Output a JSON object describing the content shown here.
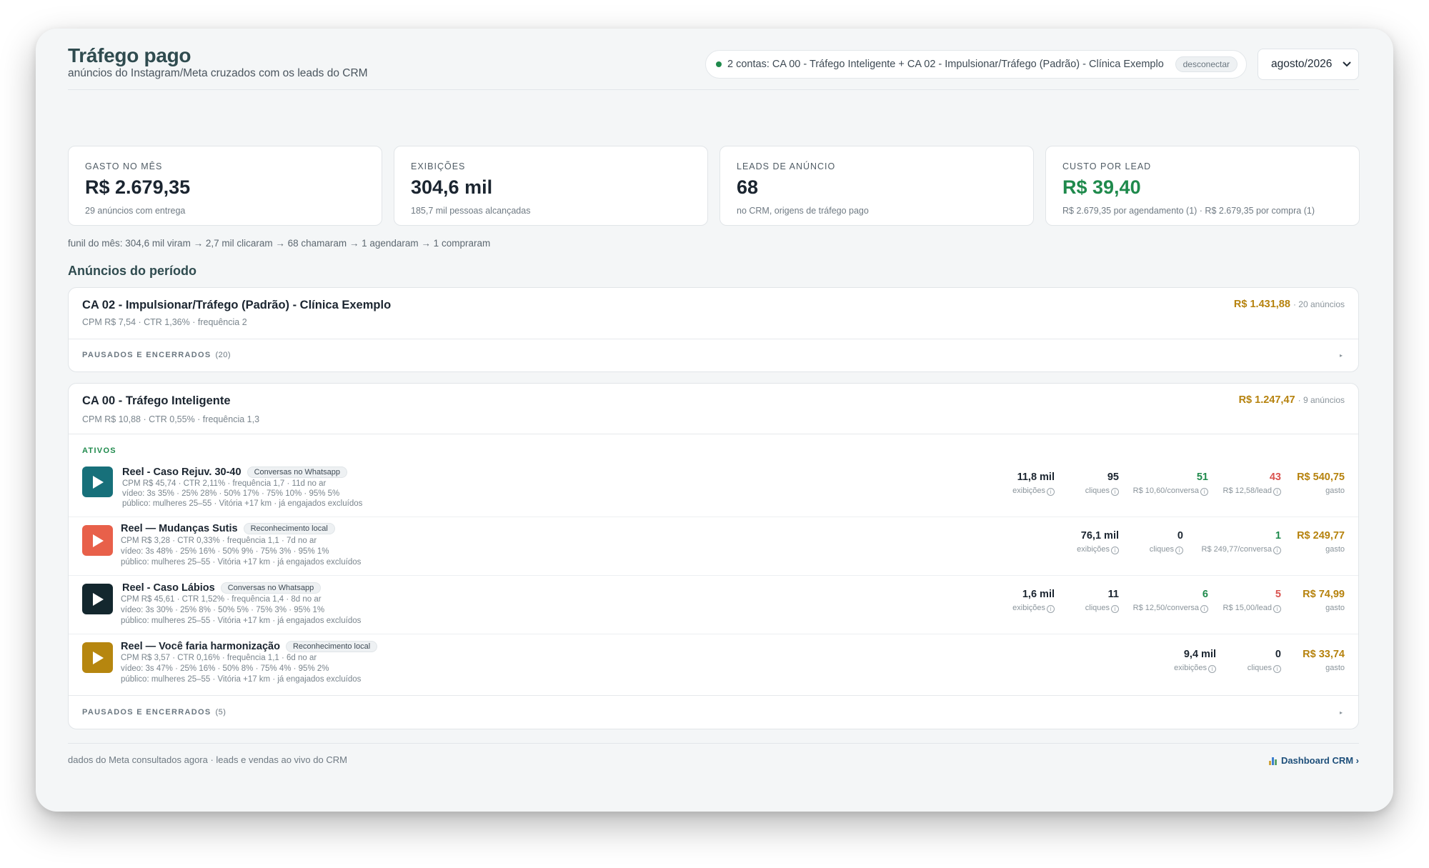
{
  "header": {
    "title": "Tráfego pago",
    "subtitle": "anúncios do Instagram/Meta cruzados com os leads do CRM",
    "accounts_text": "2 contas: CA 00 - Tráfego Inteligente + CA 02 - Impulsionar/Tráfego (Padrão) - Clínica Exemplo",
    "disconnect_label": "desconectar",
    "month": "agosto/2026"
  },
  "kpis": [
    {
      "label": "GASTO NO MÊS",
      "value": "R$ 2.679,35",
      "sub": "29 anúncios com entrega"
    },
    {
      "label": "EXIBIÇÕES",
      "value": "304,6 mil",
      "sub": "185,7 mil pessoas alcançadas"
    },
    {
      "label": "LEADS DE ANÚNCIO",
      "value": "68",
      "sub": "no CRM, origens de tráfego pago"
    },
    {
      "label": "CUSTO POR LEAD",
      "value": "R$ 39,40",
      "sub": "R$ 2.679,35 por agendamento (1) · R$ 2.679,35 por compra (1)"
    }
  ],
  "funnel": "funil do mês: 304,6 mil viram → 2,7 mil clicaram → 68 chamaram → 1 agendaram → 1 compraram",
  "section_title": "Anúncios do período",
  "accounts": [
    {
      "name": "CA 02 - Impulsionar/Tráfego (Padrão) - Clínica Exemplo",
      "meta": "CPM R$ 7,54 · CTR 1,36% · frequência 2",
      "total": "R$ 1.431,88",
      "count": "· 20 anúncios",
      "paused_label": "PAUSADOS E ENCERRADOS",
      "paused_count": "(20)"
    },
    {
      "name": "CA 00 - Tráfego Inteligente",
      "meta": "CPM R$ 10,88 · CTR 0,55% · frequência 1,3",
      "total": "R$ 1.247,47",
      "count": "· 9 anúncios",
      "active_label": "ATIVOS",
      "paused_label": "PAUSADOS E ENCERRADOS",
      "paused_count": "(5)",
      "ads": [
        {
          "name": "Reel - Caso Rejuv. 30-40",
          "badge": "Conversas no Whatsapp",
          "line1": "CPM R$ 45,74 · CTR 2,11% · frequência 1,7 · 11d no ar",
          "line2": "vídeo: 3s 35% · 25% 28% · 50% 17% · 75% 10% · 95% 5%",
          "line3": "público: mulheres 25–55 · Vitória +17 km · já engajados excluídos",
          "thumb_color": "#17707a",
          "impressions": "11,8 mil",
          "impressions_label": "exibições",
          "clicks": "95",
          "clicks_label": "cliques",
          "conversations": "51",
          "conversations_label": "R$ 10,60/conversa",
          "leads": "43",
          "leads_label": "R$ 12,58/lead",
          "spend": "R$ 540,75",
          "spend_label": "gasto"
        },
        {
          "name": "Reel — Mudanças Sutis",
          "badge": "Reconhecimento local",
          "line1": "CPM R$ 3,28 · CTR 0,33% · frequência 1,1 · 7d no ar",
          "line2": "vídeo: 3s 48% · 25% 16% · 50% 9% · 75% 3% · 95% 1%",
          "line3": "público: mulheres 25–55 · Vitória +17 km · já engajados excluídos",
          "thumb_color": "#e8604a",
          "impressions": "76,1 mil",
          "impressions_label": "exibições",
          "clicks": "0",
          "clicks_label": "cliques",
          "conversations": "1",
          "conversations_label": "R$ 249,77/conversa",
          "spend": "R$ 249,77",
          "spend_label": "gasto"
        },
        {
          "name": "Reel - Caso Lábios",
          "badge": "Conversas no Whatsapp",
          "line1": "CPM R$ 45,61 · CTR 1,52% · frequência 1,4 · 8d no ar",
          "line2": "vídeo: 3s 30% · 25% 8% · 50% 5% · 75% 3% · 95% 1%",
          "line3": "público: mulheres 25–55 · Vitória +17 km · já engajados excluídos",
          "thumb_color": "#13272e",
          "impressions": "1,6 mil",
          "impressions_label": "exibições",
          "clicks": "11",
          "clicks_label": "cliques",
          "conversations": "6",
          "conversations_label": "R$ 12,50/conversa",
          "leads": "5",
          "leads_label": "R$ 15,00/lead",
          "spend": "R$ 74,99",
          "spend_label": "gasto"
        },
        {
          "name": "Reel — Você faria harmonização",
          "badge": "Reconhecimento local",
          "line1": "CPM R$ 3,57 · CTR 0,16% · frequência 1,1 · 6d no ar",
          "line2": "vídeo: 3s 47% · 25% 16% · 50% 8% · 75% 4% · 95% 2%",
          "line3": "público: mulheres 25–55 · Vitória +17 km · já engajados excluídos",
          "thumb_color": "#b6860f",
          "impressions": "9,4 mil",
          "impressions_label": "exibições",
          "clicks": "0",
          "clicks_label": "cliques",
          "spend": "R$ 33,74",
          "spend_label": "gasto"
        }
      ]
    }
  ],
  "footer": {
    "note": "dados do Meta consultados agora · leads e vendas ao vivo do CRM",
    "dashboard_link": "Dashboard CRM ›"
  },
  "colors": {
    "accent_green": "#1f8a4c",
    "accent_gold": "#b6820d",
    "accent_red": "#d9534f",
    "link_blue": "#1d4f7a"
  },
  "icons": [
    "status-dot-icon",
    "chevron-down-icon",
    "play-icon",
    "info-icon",
    "chart-icon",
    "caret-right-icon"
  ]
}
